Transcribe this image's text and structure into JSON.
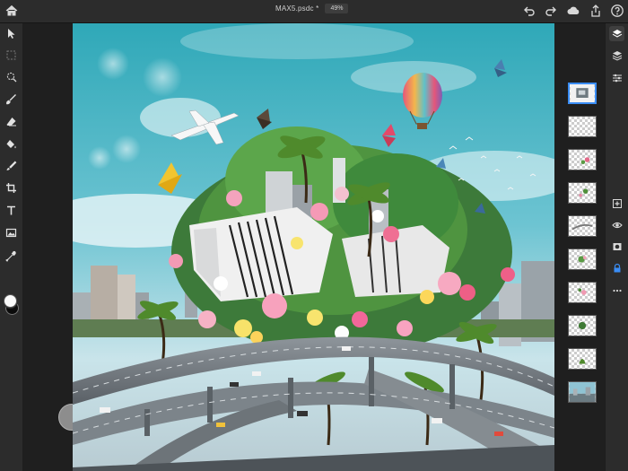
{
  "app": {
    "document_title": "MAX5.psdc *",
    "zoom": "49%"
  },
  "colors": {
    "accent": "#3a8df5",
    "toolbar_bg": "#2c2c2c",
    "workspace_bg": "#1f1f1f"
  },
  "top_actions": [
    "undo-icon",
    "redo-icon",
    "cloud-icon",
    "share-icon",
    "help-icon"
  ],
  "left_tools": [
    "select-icon",
    "marquee-icon",
    "quick-select-icon",
    "brush-icon",
    "eraser-icon",
    "fill-icon",
    "clone-stamp-icon",
    "crop-icon",
    "type-icon",
    "place-image-icon",
    "eyedropper-icon"
  ],
  "color_swatch": {
    "foreground": "#ffffff",
    "background": "#000000"
  },
  "right_panel": [
    "layers-icon",
    "layer-properties-icon",
    "adjustments-icon",
    "add-layer-icon",
    "visibility-icon",
    "mask-icon",
    "lock-icon",
    "more-icon"
  ],
  "layers": {
    "count": 10,
    "selected_index": 0
  }
}
